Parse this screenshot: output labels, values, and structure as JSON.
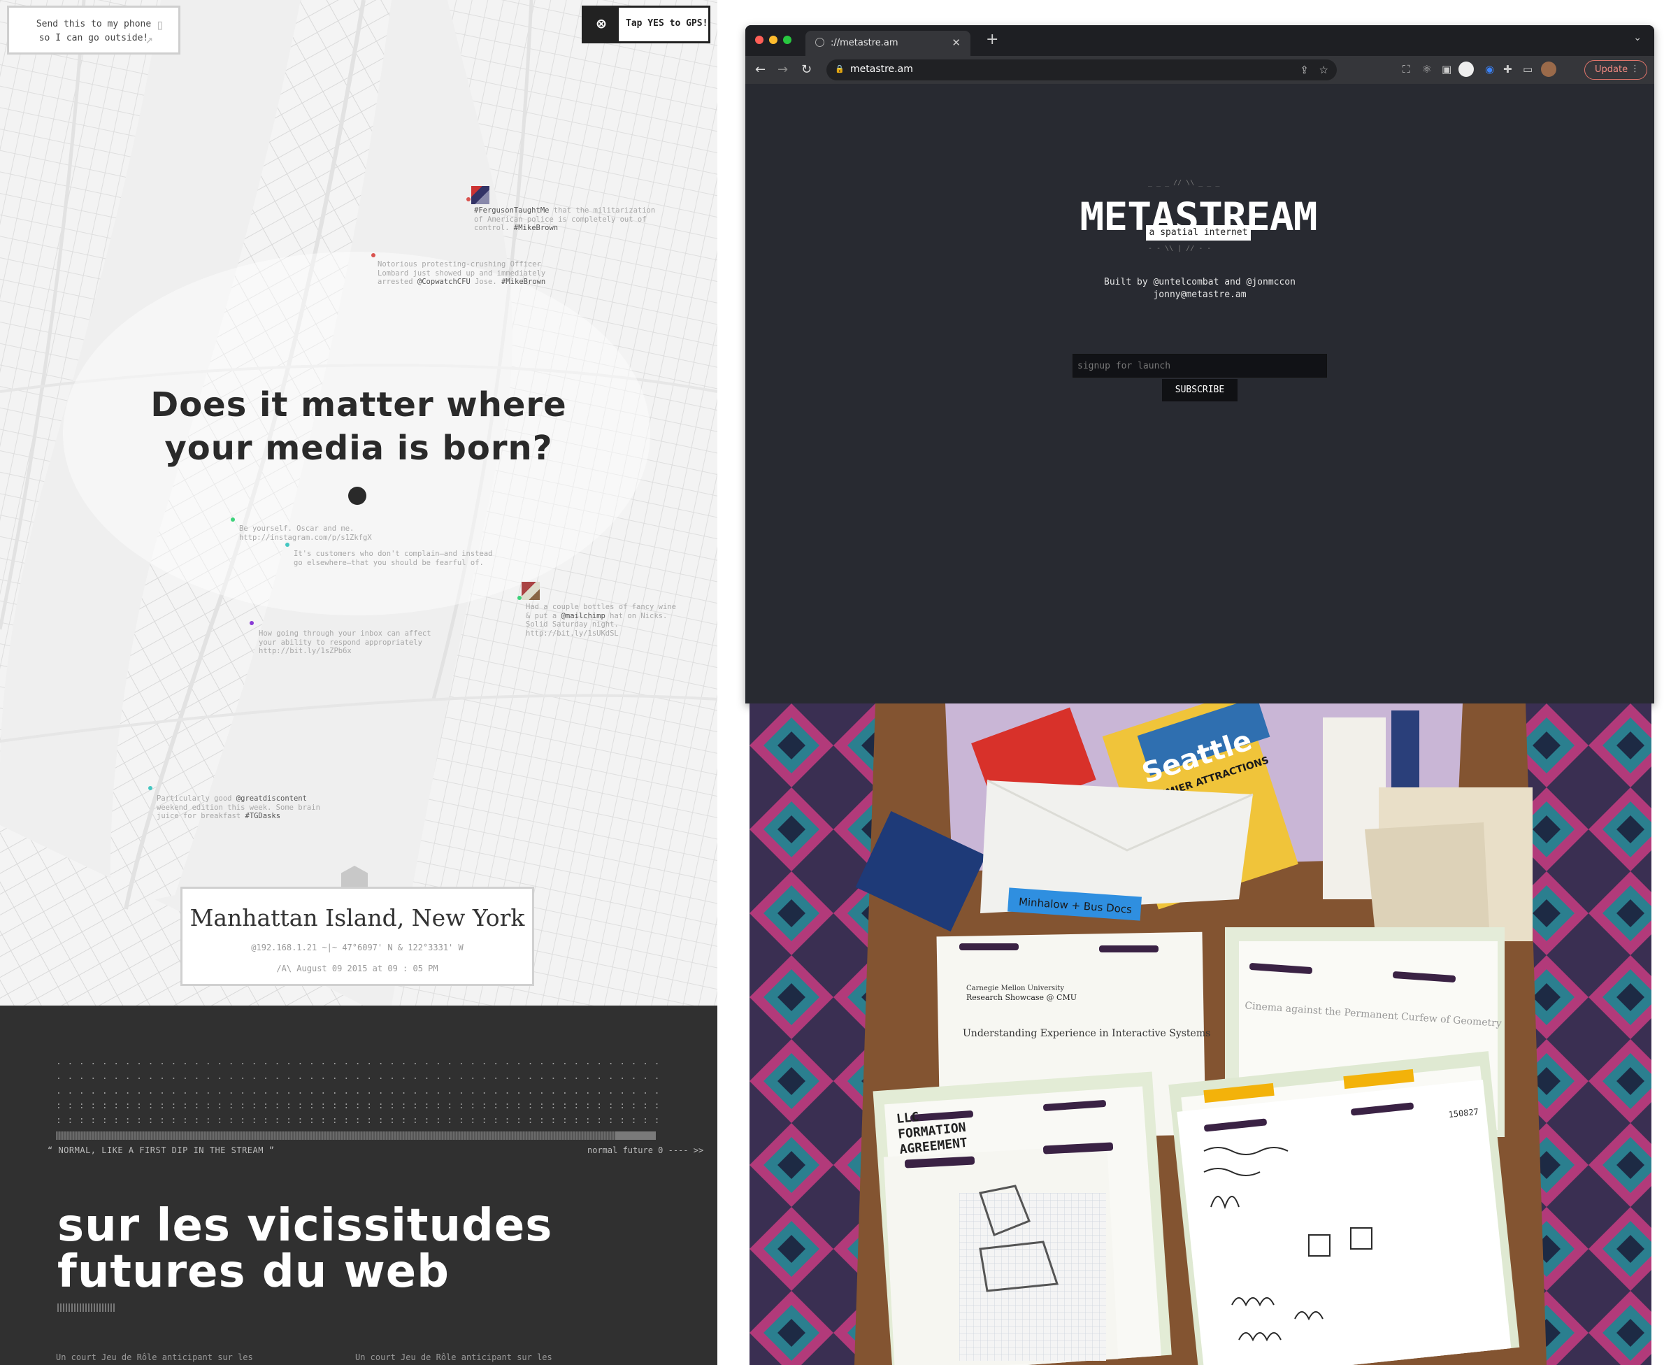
{
  "map_panel": {
    "phone_prompt_line1": "Send this to my phone",
    "phone_prompt_line2": "so I can go outside!",
    "gps_label": "Tap YES to GPS!",
    "headline_line1": "Does it matter where",
    "headline_line2": "your media is born?",
    "tweets": [
      {
        "line1a": "#FergusonTaughtMe",
        "line1b": " that the militarization",
        "line2": "of American police is completely out of",
        "line3a": "control. ",
        "line3b": "#MikeBrown"
      },
      {
        "line1": "Notorious protesting-crushing Officer",
        "line2": "Lombard just showed up and immediately",
        "line3a": "arrested ",
        "line3b": "@CopwatchCFU",
        "line3c": " Jose. ",
        "line3d": "#MikeBrown"
      },
      {
        "line1": "Be yourself. Oscar and me.",
        "line2": "http://instagram.com/p/s1ZkfgX"
      },
      {
        "line1": "It's customers who don't complain—and instead",
        "line2": "go elsewhere—that you should be fearful of."
      },
      {
        "line1": "Had a couple bottles of fancy wine",
        "line2a": "& put a ",
        "line2b": "@mailchimp",
        "line2c": " hat on Nicks.",
        "line3": "Solid Saturday night.",
        "line4": "http://bit.ly/1sUKdSL"
      },
      {
        "line1": "How going through your inbox can affect",
        "line2": "your ability to respond appropriately",
        "line3": "http://bit.ly/1sZPb6x"
      },
      {
        "line1a": "Particularly good ",
        "line1b": "@greatdiscontent",
        "line2": "weekend edition this week. Some brain",
        "line3a": "juice for breakfast ",
        "line3b": "#TGDasks"
      }
    ],
    "location_title": "Manhattan Island, New York",
    "location_meta": "@192.168.1.21  ~|~  47°6097' N & 122°3331' W",
    "location_date": "/A\\ August 09 2015 at 09 : 05 PM",
    "colors": {
      "teal": "#44c7c2",
      "green": "#3cd27a",
      "purple": "#8a3cd6",
      "red": "#d9534f"
    }
  },
  "dark_panel": {
    "dot_rows": [
      "       . . .       . .       . . . . . . . . .    . . . . . . . . . . . . . . . . . . . . . . . . . . . . . . . . . . . . . . . . . . . . . . . . . .",
      ". . . . . . . . . . . . . . . . . . . . . . . . . . . . . . . . . . . . . . . . . . . . . . . . . . . . . . . . . . . . . . . . . . . . . . . . . . . . . . . . . . . . . . .",
      ". . . . . . . . . . . . . . . . . . . . . . . . . . . . . . . . . . . . . . . . . . . . . . . . . . . . . . . . . . . . . . . : : : : : : : : : : : : : : : : : : : : : : : :",
      ": : : : : : : : : : : : : : : : : : : : : : : : : : : : : : : : : : : : : : : : : : : : : : : : : : : : : : : : : : : : : : : : : : : : : : : : : : : : : : : : : : : : : :",
      ": : : : : : : : : : : : : : : : : : : : : : : : : : : : : : : : : : : : : : : : : : : : : : : : : : : : : : : : : : : : : : : : : : : : : : : : : : : : : : : : : : : : : :"
    ],
    "stream_quote": "“ NORMAL, LIKE A FIRST DIP IN THE STREAM ”",
    "stream_right": "normal future  0 ---- >>",
    "title_line1": "sur les vicissitudes",
    "title_line2": "futures du web",
    "blurb_left": "Un court Jeu de Rôle anticipant sur les",
    "blurb_right": "Un court Jeu de Rôle anticipant sur les"
  },
  "browser": {
    "tab_title": "://metastre.am",
    "url": "metastre.am",
    "update_label": "Update",
    "logo": "METASTREAM",
    "tagline": "a spatial internet",
    "logo_deco_top": "_ _ _ // \\\\ _ _ _",
    "logo_deco_bottom": "- - \\\\ | // - -",
    "built_by": "Built by @untelcombat and @jonmccon",
    "email": "jonny@metastre.am",
    "signup_placeholder": "signup for launch",
    "subscribe_label": "SUBSCRIBE"
  },
  "photo": {
    "seattle_title": "Seattle",
    "seattle_sub": "PREMIER ATTRACTIONS",
    "label_tape": "Minhalow + Bus Docs",
    "paper_heading1": "Carnegie Mellon University",
    "paper_heading2": "Research Showcase @ CMU",
    "paper_title": "Understanding Experience in Interactive Systems",
    "paper_right": "Cinema against the Permanent Curfew of Geometry",
    "llc_line1": "LLC",
    "llc_line2": "FORMATION",
    "llc_line3": "AGREEMENT",
    "page_num": "150827"
  }
}
